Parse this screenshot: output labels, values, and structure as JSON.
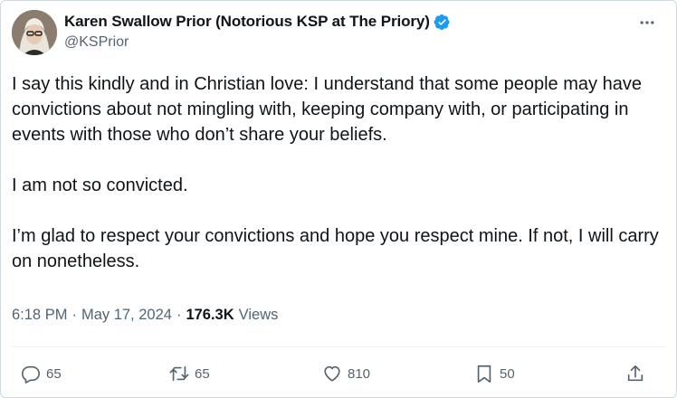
{
  "author": {
    "display_name": "Karen Swallow Prior (Notorious KSP at The Priory)",
    "handle": "@KSPrior",
    "verified_icon": "verified-badge-icon",
    "verified_color": "#1d9bf0"
  },
  "tweet": {
    "paragraphs": [
      "I say this kindly and in Christian love: I understand that some people may have convictions about not mingling with, keeping company with, or participating in events with those who don’t share your beliefs.",
      "I am not so convicted.",
      "I’m glad to respect your convictions and hope you respect mine. If not, I will carry on nonetheless."
    ]
  },
  "meta": {
    "time": "6:18 PM",
    "separator": "·",
    "date": "May 17, 2024",
    "views_count": "176.3K",
    "views_label": "Views"
  },
  "actions": {
    "replies": "65",
    "reposts": "65",
    "likes": "810",
    "bookmarks": "50"
  },
  "colors": {
    "text_primary": "#0f1419",
    "text_secondary": "#536471",
    "border": "#cfd9de"
  }
}
